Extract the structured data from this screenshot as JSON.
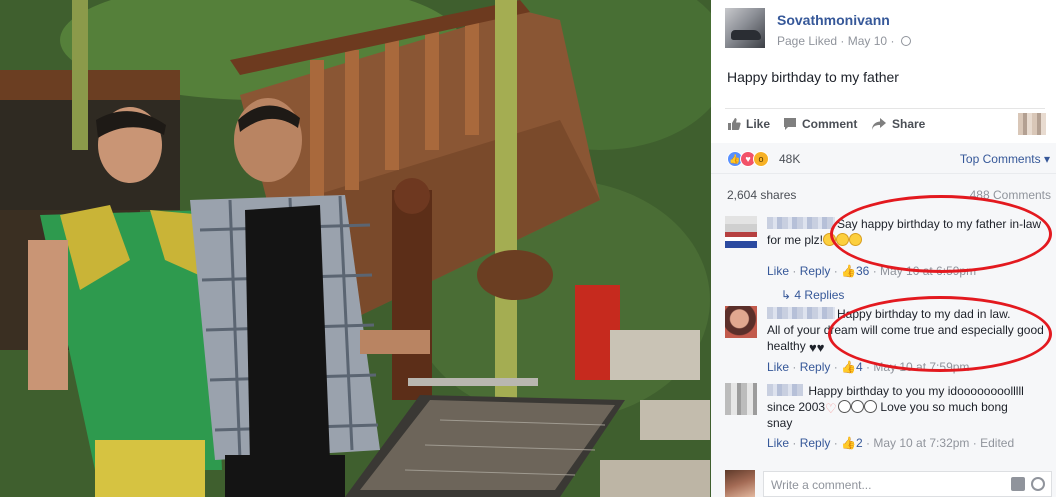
{
  "post": {
    "page_name": "Sovathmonivann",
    "liked_status": "Page Liked",
    "date": "May 10",
    "separator": "·",
    "text": "Happy birthday to my father"
  },
  "actions": {
    "like": "Like",
    "comment": "Comment",
    "share": "Share"
  },
  "reactions": {
    "count": "48K",
    "types": [
      "like-icon",
      "love-icon",
      "wow-icon"
    ],
    "sort_label": "Top Comments",
    "sort_caret": "▾"
  },
  "stats": {
    "shares": "2,604 shares",
    "comments": "488 Comments"
  },
  "comments": [
    {
      "text_line1": "Say happy birthday to my father in-law",
      "text_line2": "for me plz!",
      "like": "Like",
      "reply": "Reply",
      "likes": "36",
      "time": "May 10 at 6:59pm",
      "replies": "4 Replies"
    },
    {
      "text_line1": "Happy birthday to my dad in law.",
      "text_line2": "All of your dream will come true and especially good",
      "text_line3": "healthy",
      "like": "Like",
      "reply": "Reply",
      "likes": "4",
      "time": "May 10 at 7:59pm"
    },
    {
      "text_line1": "Happy birthday to you my idoooooooolllll",
      "text_line2": "since 2003",
      "text_line2b": "Love you so much bong",
      "text_line3": "snay",
      "like": "Like",
      "reply": "Reply",
      "likes": "2",
      "time": "May 10 at 7:32pm",
      "edited": "Edited"
    }
  ],
  "composer": {
    "placeholder": "Write a comment..."
  },
  "colors": {
    "link_blue": "#365899",
    "annotation_red": "#e3191f",
    "like_blue": "#5890ff"
  }
}
